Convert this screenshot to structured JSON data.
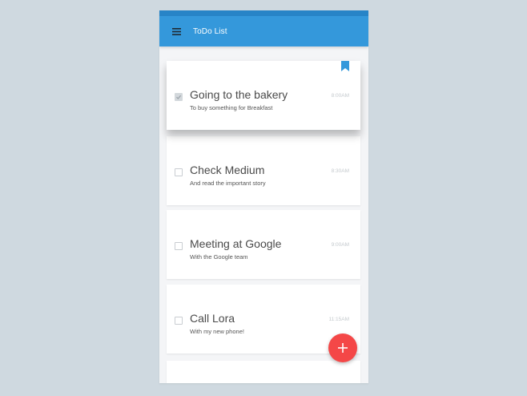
{
  "app": {
    "title": "ToDo List",
    "accent_color": "#3498db",
    "statusbar_color": "#2784c7",
    "fab_color": "#f44747",
    "menu_icon": "hamburger-menu-icon",
    "fab_icon": "plus-icon"
  },
  "tasks": [
    {
      "title": "Going to the bakery",
      "description": "To buy something for Breakfast",
      "time": "8:00AM",
      "checked": true,
      "bookmarked": true
    },
    {
      "title": "Check Medium",
      "description": "And read the important story",
      "time": "8:30AM",
      "checked": false,
      "bookmarked": false
    },
    {
      "title": "Meeting at Google",
      "description": "With the Google team",
      "time": "9:00AM",
      "checked": false,
      "bookmarked": false
    },
    {
      "title": "Call Lora",
      "description": "With my new phone!",
      "time": "11:15AM",
      "checked": false,
      "bookmarked": false
    }
  ]
}
